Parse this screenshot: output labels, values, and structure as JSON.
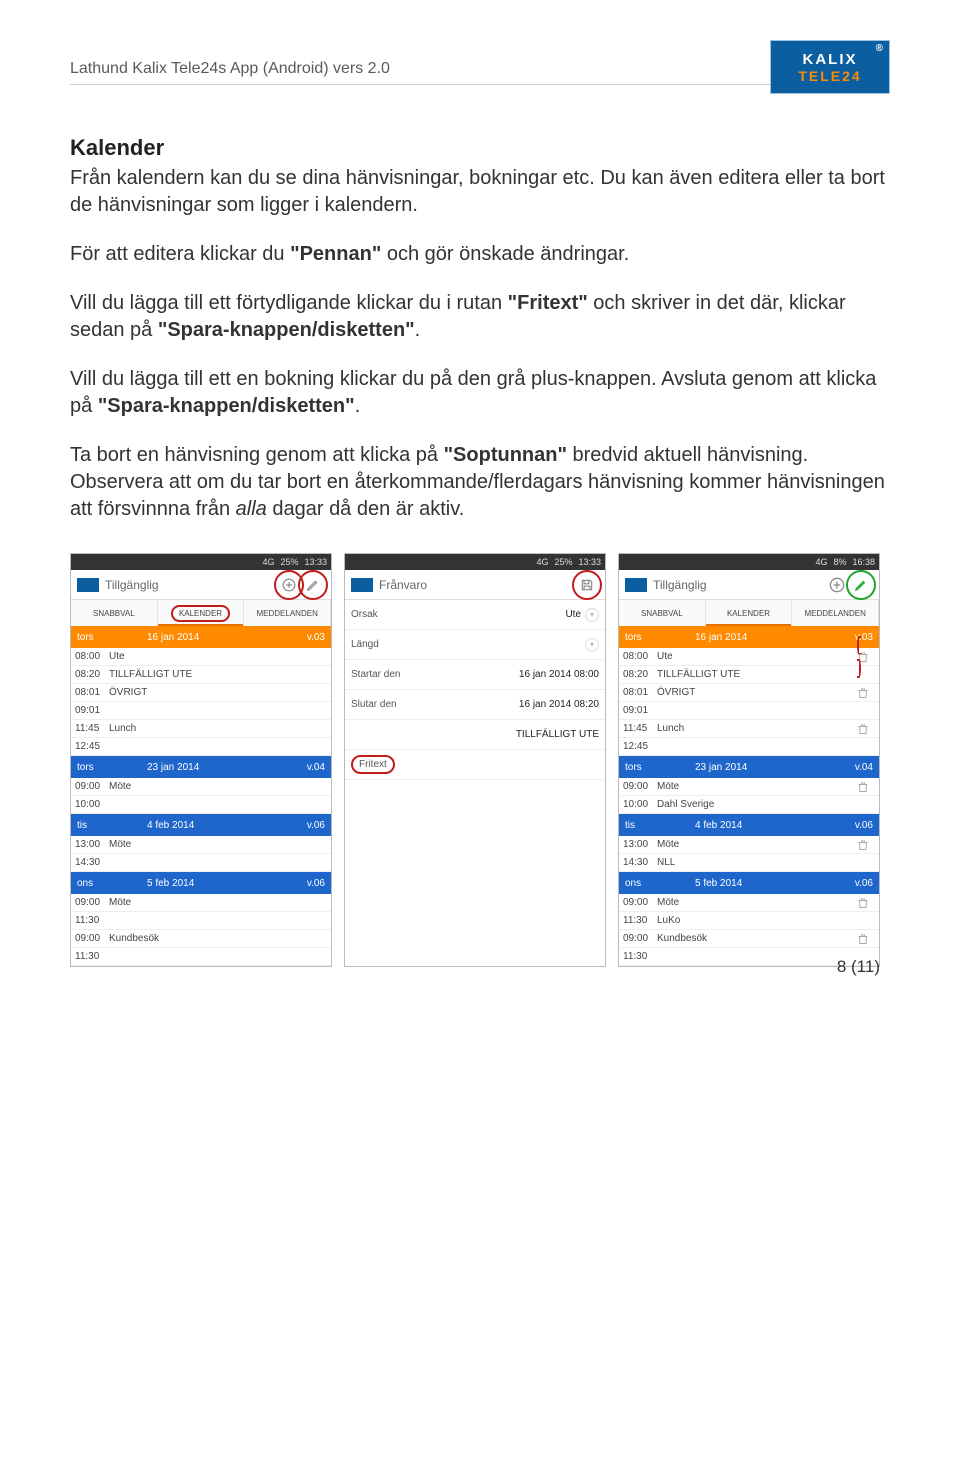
{
  "doc": {
    "header": "Lathund Kalix Tele24s App (Android) vers 2.0",
    "logo_line1": "KALIX",
    "logo_line2": "TELE24",
    "logo_reg": "®"
  },
  "text": {
    "title": "Kalender",
    "p1": "Från kalendern kan du se dina hänvisningar, bokningar etc. Du kan även editera eller ta bort de hänvisningar som ligger i kalendern.",
    "p2a": "För att editera klickar du ",
    "p2b": "\"Pennan\"",
    "p2c": " och gör önskade ändringar.",
    "p3a": "Vill du lägga till ett förtydligande klickar du i rutan ",
    "p3b": "\"Fritext\"",
    "p3c": " och skriver in det där, klickar sedan på ",
    "p3d": "\"Spara-knappen/disketten\"",
    "p3e": ".",
    "p4a": "Vill du lägga till ett en bokning klickar du på den grå plus-knappen. Avsluta genom att klicka på ",
    "p4b": "\"Spara-knappen/disketten\"",
    "p4c": ".",
    "p5a": "Ta bort en hänvisning genom att klicka på ",
    "p5b": "\"Soptunnan\"",
    "p5c": " bredvid aktuell hänvisning. Observera att om du tar bort en återkommande/flerdagars hänvisning kommer hänvisningen att försvinnna från ",
    "p5d": "alla",
    "p5e": " dagar då den är aktiv."
  },
  "footer": "8 (11)",
  "status": {
    "signal": "4G",
    "net": "◢",
    "batt": "25%",
    "time1": "13:33",
    "time3": "16:38",
    "batt3": "8%"
  },
  "s1": {
    "title": "Tillgänglig",
    "tabs": [
      "SNABBVAL",
      "KALENDER",
      "MEDDELANDEN"
    ],
    "days": [
      {
        "cls": "orange",
        "dname": "tors",
        "date": "16 jan 2014",
        "week": "v.03",
        "events": [
          {
            "t1": "08:00",
            "txt": "Ute"
          },
          {
            "t1": "08:20",
            "txt": "TILLFÄLLIGT UTE"
          },
          {
            "t1": "08:01",
            "txt": "ÖVRIGT"
          },
          {
            "t1": "09:01",
            "txt": ""
          },
          {
            "t1": "11:45",
            "txt": "Lunch"
          },
          {
            "t1": "12:45",
            "txt": ""
          }
        ]
      },
      {
        "cls": "blue",
        "dname": "tors",
        "date": "23 jan 2014",
        "week": "v.04",
        "events": [
          {
            "t1": "09:00",
            "txt": "Möte"
          },
          {
            "t1": "10:00",
            "txt": ""
          }
        ]
      },
      {
        "cls": "blue",
        "dname": "tis",
        "date": "4 feb 2014",
        "week": "v.06",
        "events": [
          {
            "t1": "13:00",
            "txt": "Möte"
          },
          {
            "t1": "14:30",
            "txt": ""
          }
        ]
      },
      {
        "cls": "blue",
        "dname": "ons",
        "date": "5 feb 2014",
        "week": "v.06",
        "events": [
          {
            "t1": "09:00",
            "txt": "Möte"
          },
          {
            "t1": "11:30",
            "txt": ""
          },
          {
            "t1": "09:00",
            "txt": "Kundbesök"
          },
          {
            "t1": "11:30",
            "txt": ""
          }
        ]
      }
    ]
  },
  "s2": {
    "title": "Frånvaro",
    "rows": [
      {
        "lab": "Orsak",
        "val": "Ute",
        "chev": true
      },
      {
        "lab": "Längd",
        "val": "",
        "chev": true
      },
      {
        "lab": "Startar den",
        "val": "16 jan 2014 08:00",
        "chev": false
      },
      {
        "lab": "Slutar den",
        "val": "16 jan 2014 08:20",
        "chev": false
      },
      {
        "lab": "",
        "val": "TILLFÄLLIGT UTE",
        "chev": false
      },
      {
        "lab": "Fritext",
        "val": "",
        "chev": false,
        "circled": true
      }
    ]
  },
  "s3": {
    "title": "Tillgänglig",
    "tabs": [
      "SNABBVAL",
      "KALENDER",
      "MEDDELANDEN"
    ],
    "days": [
      {
        "cls": "orange",
        "dname": "tors",
        "date": "16 jan 2014",
        "week": "v.03",
        "events": [
          {
            "t1": "08:00",
            "txt": "Ute",
            "trash": true
          },
          {
            "t1": "08:20",
            "txt": "TILLFÄLLIGT UTE",
            "trash": false
          },
          {
            "t1": "08:01",
            "txt": "ÖVRIGT",
            "trash": true
          },
          {
            "t1": "09:01",
            "txt": "",
            "trash": false
          },
          {
            "t1": "11:45",
            "txt": "Lunch",
            "trash": true
          },
          {
            "t1": "12:45",
            "txt": "",
            "trash": false
          }
        ]
      },
      {
        "cls": "blue",
        "dname": "tors",
        "date": "23 jan 2014",
        "week": "v.04",
        "events": [
          {
            "t1": "09:00",
            "txt": "Möte",
            "trash": true
          },
          {
            "t1": "10:00",
            "txt": "Dahl Sverige",
            "trash": false
          }
        ]
      },
      {
        "cls": "blue",
        "dname": "tis",
        "date": "4 feb 2014",
        "week": "v.06",
        "events": [
          {
            "t1": "13:00",
            "txt": "Möte",
            "trash": true
          },
          {
            "t1": "14:30",
            "txt": "NLL",
            "trash": false
          }
        ]
      },
      {
        "cls": "blue",
        "dname": "ons",
        "date": "5 feb 2014",
        "week": "v.06",
        "events": [
          {
            "t1": "09:00",
            "txt": "Möte",
            "trash": true
          },
          {
            "t1": "11:30",
            "txt": "LuKo",
            "trash": false
          },
          {
            "t1": "09:00",
            "txt": "Kundbesök",
            "trash": true
          },
          {
            "t1": "11:30",
            "txt": "",
            "trash": false
          }
        ]
      }
    ]
  }
}
